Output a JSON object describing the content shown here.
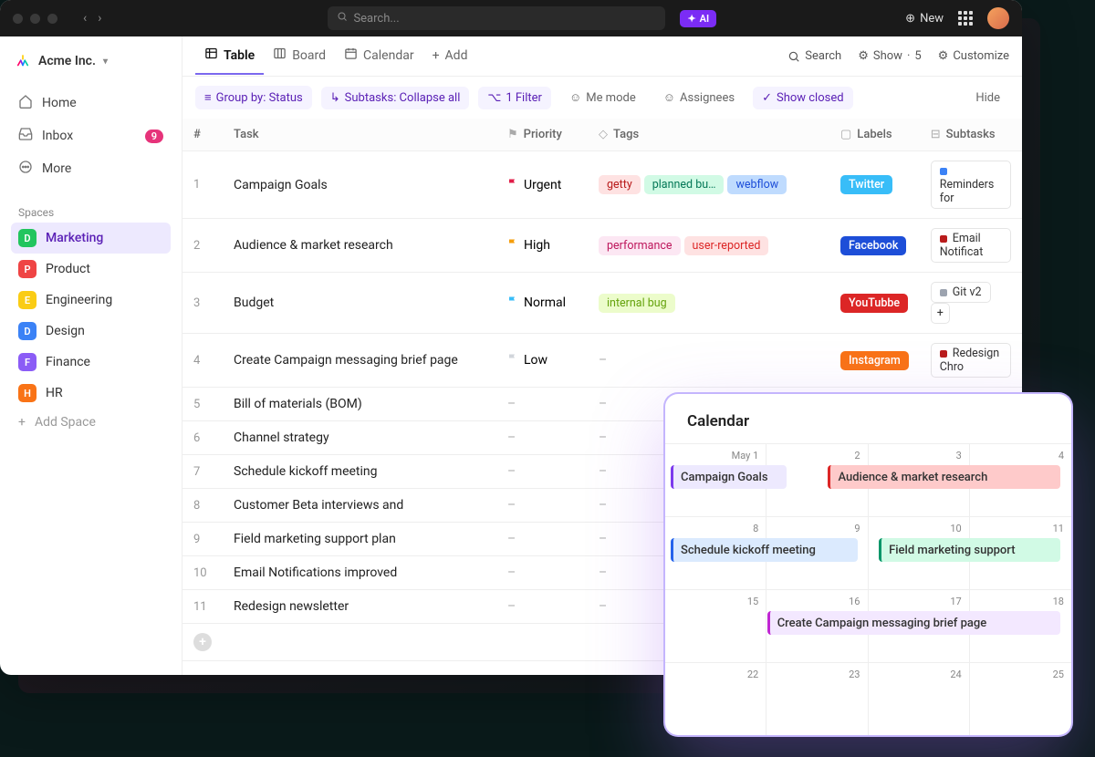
{
  "titlebar": {
    "search_placeholder": "Search...",
    "ai_label": "AI",
    "new_label": "New"
  },
  "sidebar": {
    "workspace_name": "Acme Inc.",
    "nav": [
      {
        "label": "Home",
        "icon": "home"
      },
      {
        "label": "Inbox",
        "icon": "inbox",
        "badge": "9"
      },
      {
        "label": "More",
        "icon": "more"
      }
    ],
    "spaces_header": "Spaces",
    "spaces": [
      {
        "letter": "D",
        "label": "Marketing",
        "color": "#22c55e",
        "active": true
      },
      {
        "letter": "P",
        "label": "Product",
        "color": "#ef4444"
      },
      {
        "letter": "E",
        "label": "Engineering",
        "color": "#facc15"
      },
      {
        "letter": "D",
        "label": "Design",
        "color": "#3b82f6"
      },
      {
        "letter": "F",
        "label": "Finance",
        "color": "#8b5cf6"
      },
      {
        "letter": "H",
        "label": "HR",
        "color": "#f97316"
      }
    ],
    "add_space_label": "Add Space"
  },
  "views": {
    "tabs": [
      {
        "label": "Table",
        "icon": "table",
        "active": true
      },
      {
        "label": "Board",
        "icon": "board"
      },
      {
        "label": "Calendar",
        "icon": "calendar"
      },
      {
        "label": "Add",
        "icon": "plus"
      }
    ],
    "right": {
      "search": "Search",
      "show": "Show",
      "show_count": "5",
      "customize": "Customize"
    }
  },
  "filters": {
    "group_by": "Group by: Status",
    "subtasks": "Subtasks: Collapse all",
    "filter": "1 Filter",
    "me_mode": "Me mode",
    "assignees": "Assignees",
    "show_closed": "Show closed",
    "hide": "Hide"
  },
  "table": {
    "headers": {
      "num": "#",
      "task": "Task",
      "priority": "Priority",
      "tags": "Tags",
      "labels": "Labels",
      "subtasks": "Subtasks"
    },
    "rows": [
      {
        "num": "1",
        "task": "Campaign Goals",
        "priority": {
          "text": "Urgent",
          "color": "#e11d48"
        },
        "tags": [
          {
            "text": "getty",
            "bg": "#fee2e2",
            "fg": "#b91c1c"
          },
          {
            "text": "planned bu…",
            "bg": "#d1fae5",
            "fg": "#047857"
          },
          {
            "text": "webflow",
            "bg": "#bfdbfe",
            "fg": "#1d4ed8"
          }
        ],
        "label": {
          "text": "Twitter",
          "bg": "#38bdf8"
        },
        "subtask": {
          "text": "Reminders for",
          "bullet": "#3b82f6"
        }
      },
      {
        "num": "2",
        "task": "Audience & market research",
        "priority": {
          "text": "High",
          "color": "#f59e0b"
        },
        "tags": [
          {
            "text": "performance",
            "bg": "#fce7f3",
            "fg": "#be185d"
          },
          {
            "text": "user-reported",
            "bg": "#fee2e2",
            "fg": "#dc2626"
          }
        ],
        "label": {
          "text": "Facebook",
          "bg": "#1d4ed8"
        },
        "subtask": {
          "text": "Email Notificat",
          "bullet": "#b91c1c"
        }
      },
      {
        "num": "3",
        "task": "Budget",
        "priority": {
          "text": "Normal",
          "color": "#38bdf8"
        },
        "tags": [
          {
            "text": "internal bug",
            "bg": "#ecfccb",
            "fg": "#65a30d"
          }
        ],
        "label": {
          "text": "YouTubbe",
          "bg": "#dc2626"
        },
        "subtask": {
          "text": "Git v2",
          "bullet": "#9ca3af",
          "plus": true
        }
      },
      {
        "num": "4",
        "task": "Create Campaign messaging brief page",
        "priority": {
          "text": "Low",
          "color": "#d1d5db"
        },
        "tags_dash": true,
        "label": {
          "text": "Instagram",
          "bg": "#f97316"
        },
        "subtask": {
          "text": "Redesign Chro",
          "bullet": "#b91c1c"
        }
      },
      {
        "num": "5",
        "task": "Bill of materials (BOM)",
        "all_dash": true
      },
      {
        "num": "6",
        "task": "Channel strategy",
        "all_dash": true
      },
      {
        "num": "7",
        "task": "Schedule kickoff meeting",
        "all_dash": true
      },
      {
        "num": "8",
        "task": "Customer Beta interviews and",
        "all_dash": true
      },
      {
        "num": "9",
        "task": "Field marketing support plan",
        "all_dash": true
      },
      {
        "num": "10",
        "task": "Email Notifications improved",
        "all_dash": true
      },
      {
        "num": "11",
        "task": "Redesign newsletter",
        "all_dash": true
      }
    ]
  },
  "calendar": {
    "title": "Calendar",
    "dates": [
      "May 1",
      "2",
      "3",
      "4",
      "8",
      "9",
      "10",
      "11",
      "15",
      "16",
      "17",
      "18",
      "22",
      "23",
      "24",
      "25"
    ],
    "events": [
      {
        "text": "Campaign Goals",
        "row": 0,
        "start": 0,
        "span": 1.25,
        "bg": "#ede9fe",
        "border": "#7c3aed"
      },
      {
        "text": "Audience & market research",
        "row": 0,
        "start": 1.55,
        "span": 2.4,
        "bg": "#fecaca",
        "border": "#dc2626"
      },
      {
        "text": "Schedule kickoff meeting",
        "row": 1,
        "start": 0,
        "span": 1.95,
        "bg": "#dbeafe",
        "border": "#2563eb"
      },
      {
        "text": "Field marketing support",
        "row": 1,
        "start": 2.05,
        "span": 1.9,
        "bg": "#d1fae5",
        "border": "#059669"
      },
      {
        "text": "Create Campaign messaging brief page",
        "row": 2,
        "start": 0.95,
        "span": 3,
        "bg": "#f3e8ff",
        "border": "#c026d3"
      }
    ]
  }
}
